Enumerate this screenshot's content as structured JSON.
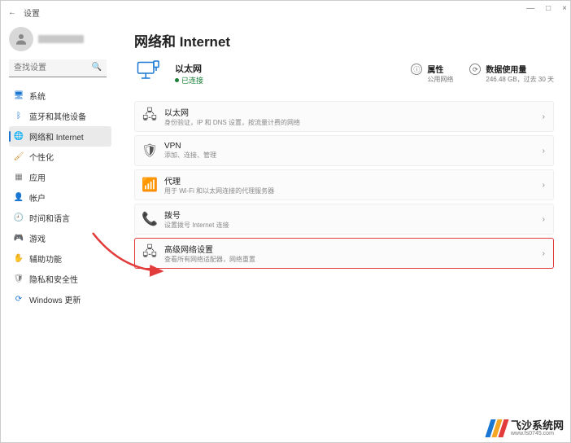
{
  "window": {
    "back": "←",
    "title": "设置",
    "min": "—",
    "max": "□",
    "close": "×"
  },
  "user": {
    "name": "用户"
  },
  "search": {
    "placeholder": "查找设置"
  },
  "nav": [
    {
      "icon": "🖥",
      "color": "#1976d2",
      "label": "系统"
    },
    {
      "icon": "ᛒ",
      "color": "#1976d2",
      "label": "蓝牙和其他设备"
    },
    {
      "icon": "🌐",
      "color": "#1976d2",
      "label": "网络和 Internet",
      "active": true
    },
    {
      "icon": "🖌",
      "color": "#c98b2e",
      "label": "个性化"
    },
    {
      "icon": "▦",
      "color": "#777",
      "label": "应用"
    },
    {
      "icon": "👤",
      "color": "#777",
      "label": "帐户"
    },
    {
      "icon": "🕘",
      "color": "#777",
      "label": "时间和语言"
    },
    {
      "icon": "🎮",
      "color": "#777",
      "label": "游戏"
    },
    {
      "icon": "✋",
      "color": "#1976d2",
      "label": "辅助功能"
    },
    {
      "icon": "🛡",
      "color": "#777",
      "label": "隐私和安全性"
    },
    {
      "icon": "⟳",
      "color": "#1976d2",
      "label": "Windows 更新"
    }
  ],
  "page": {
    "title": "网络和 Internet",
    "status": {
      "title": "以太网",
      "sub": "已连接"
    },
    "cards": [
      {
        "icon": "ⓘ",
        "title": "属性",
        "sub": "公用网络"
      },
      {
        "icon": "⟳",
        "title": "数据使用量",
        "sub": "246.48 GB，过去 30 天"
      }
    ],
    "items": [
      {
        "icon": "🖧",
        "title": "以太网",
        "sub": "身份验证，IP 和 DNS 设置，按流量计费的网络"
      },
      {
        "icon": "🛡",
        "title": "VPN",
        "sub": "添加、连接、管理"
      },
      {
        "icon": "📶",
        "title": "代理",
        "sub": "用于 Wi-Fi 和以太网连接的代理服务器"
      },
      {
        "icon": "📞",
        "title": "拨号",
        "sub": "设置拨号 Internet 连接"
      },
      {
        "icon": "🖧",
        "title": "高级网络设置",
        "sub": "查看所有网络适配器，网络重置",
        "hl": true
      }
    ]
  },
  "watermark": {
    "line1": "飞沙系统网",
    "line2": "www.fs0745.com"
  }
}
